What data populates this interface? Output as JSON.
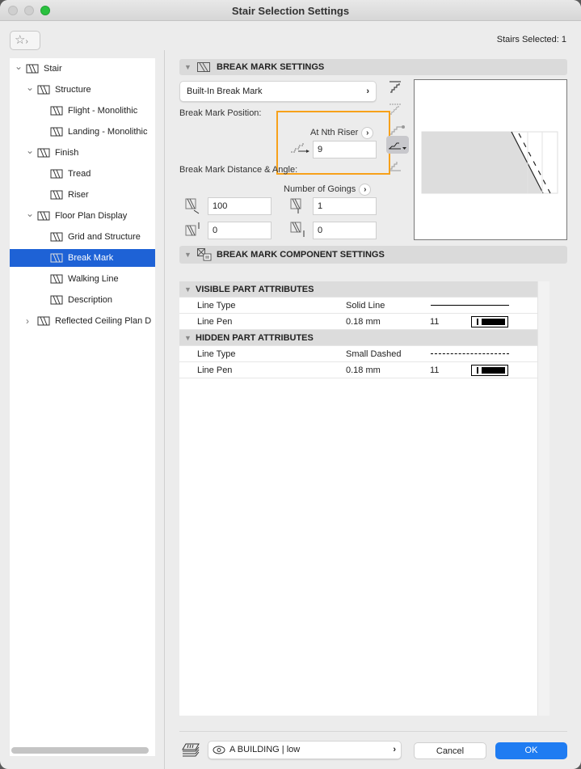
{
  "window": {
    "title": "Stair Selection Settings",
    "selection_count": "Stairs Selected: 1"
  },
  "sidebar": {
    "items": [
      {
        "label": "Stair",
        "level": 0,
        "expanded": true,
        "icon": "stair-icon"
      },
      {
        "label": "Structure",
        "level": 1,
        "expanded": true,
        "icon": "structure-icon"
      },
      {
        "label": "Flight - Monolithic",
        "level": 2,
        "icon": "flight-icon"
      },
      {
        "label": "Landing - Monolithic",
        "level": 2,
        "icon": "landing-icon"
      },
      {
        "label": "Finish",
        "level": 1,
        "expanded": true,
        "icon": "finish-icon"
      },
      {
        "label": "Tread",
        "level": 2,
        "icon": "tread-icon"
      },
      {
        "label": "Riser",
        "level": 2,
        "icon": "riser-icon"
      },
      {
        "label": "Floor Plan Display",
        "level": 1,
        "expanded": true,
        "icon": "floor-plan-icon"
      },
      {
        "label": "Grid and Structure",
        "level": 2,
        "icon": "grid-icon"
      },
      {
        "label": "Break Mark",
        "level": 2,
        "selected": true,
        "icon": "break-mark-icon"
      },
      {
        "label": "Walking Line",
        "level": 2,
        "icon": "walking-line-icon"
      },
      {
        "label": "Description",
        "level": 2,
        "icon": "description-icon"
      },
      {
        "label": "Reflected Ceiling Plan D",
        "level": 1,
        "expanded": false,
        "icon": "ceiling-plan-icon"
      }
    ]
  },
  "break_mark": {
    "section_title": "BREAK MARK SETTINGS",
    "type_value": "Built-In Break Mark",
    "position_label": "Break Mark Position:",
    "position_mode": "At Nth Riser",
    "riser_value": "9",
    "distance_label": "Break Mark Distance & Angle:",
    "goings_label": "Number of Goings",
    "distance_value": "100",
    "goings_value": "1",
    "offset_value": "0",
    "angle_offset_value": "0",
    "highlight_color": "#f7a11a"
  },
  "component": {
    "section_title": "BREAK MARK COMPONENT SETTINGS",
    "groups": [
      {
        "title": "VISIBLE PART ATTRIBUTES",
        "rows": [
          {
            "name": "Line Type",
            "value": "Solid Line",
            "extra": "",
            "preview": "solid"
          },
          {
            "name": "Line Pen",
            "value": "0.18 mm",
            "extra": "11",
            "preview": "pen"
          }
        ]
      },
      {
        "title": "HIDDEN PART ATTRIBUTES",
        "rows": [
          {
            "name": "Line Type",
            "value": "Small Dashed",
            "extra": "",
            "preview": "dashed"
          },
          {
            "name": "Line Pen",
            "value": "0.18 mm",
            "extra": "11",
            "preview": "pen"
          }
        ]
      }
    ]
  },
  "footer": {
    "layer": "A BUILDING | low",
    "cancel": "Cancel",
    "ok": "OK",
    "accent": "#1f7cf2"
  }
}
